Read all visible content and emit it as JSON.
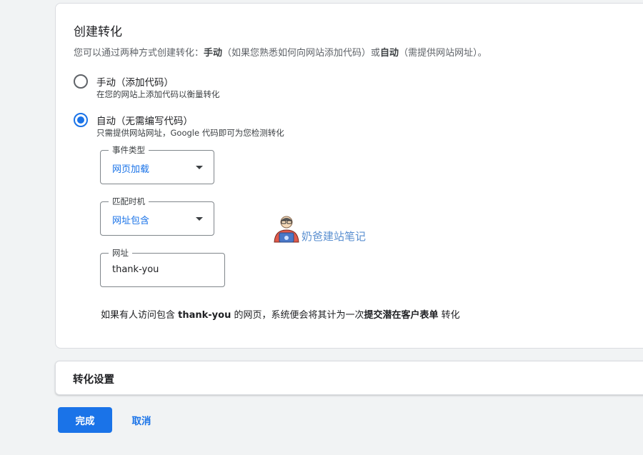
{
  "create": {
    "title": "创建转化",
    "desc": {
      "prefix": "您可以通过两种方式创建转化：",
      "manual_bold": "手动",
      "manual_paren": "（如果您熟悉如何向网站添加代码）或",
      "auto_bold": "自动",
      "auto_paren": "（需提供网站网址）。"
    },
    "options": [
      {
        "label": "手动（添加代码）",
        "sub": "在您的网站上添加代码以衡量转化",
        "selected": false
      },
      {
        "label": "自动（无需编写代码）",
        "sub": "只需提供网站网址，Google 代码即可为您检测转化",
        "selected": true
      }
    ],
    "event_type": {
      "label": "事件类型",
      "value": "网页加载"
    },
    "match_timing": {
      "label": "匹配时机",
      "value": "网址包含"
    },
    "url": {
      "label": "网址",
      "value": "thank-you"
    },
    "summary": {
      "prefix": "如果有人访问包含 ",
      "url_bold": "thank-you",
      "middle": " 的网页，系统便会将其计为一次",
      "type_bold": "提交潜在客户表单",
      "suffix": " 转化"
    }
  },
  "watermark": {
    "text": "奶爸建站笔记"
  },
  "settings": {
    "title": "转化设置"
  },
  "actions": {
    "done_label": "完成",
    "cancel_label": "取消"
  },
  "colors": {
    "accent": "#1a73e8",
    "page_bg": "#f1f3f4",
    "border": "#dadce0"
  }
}
